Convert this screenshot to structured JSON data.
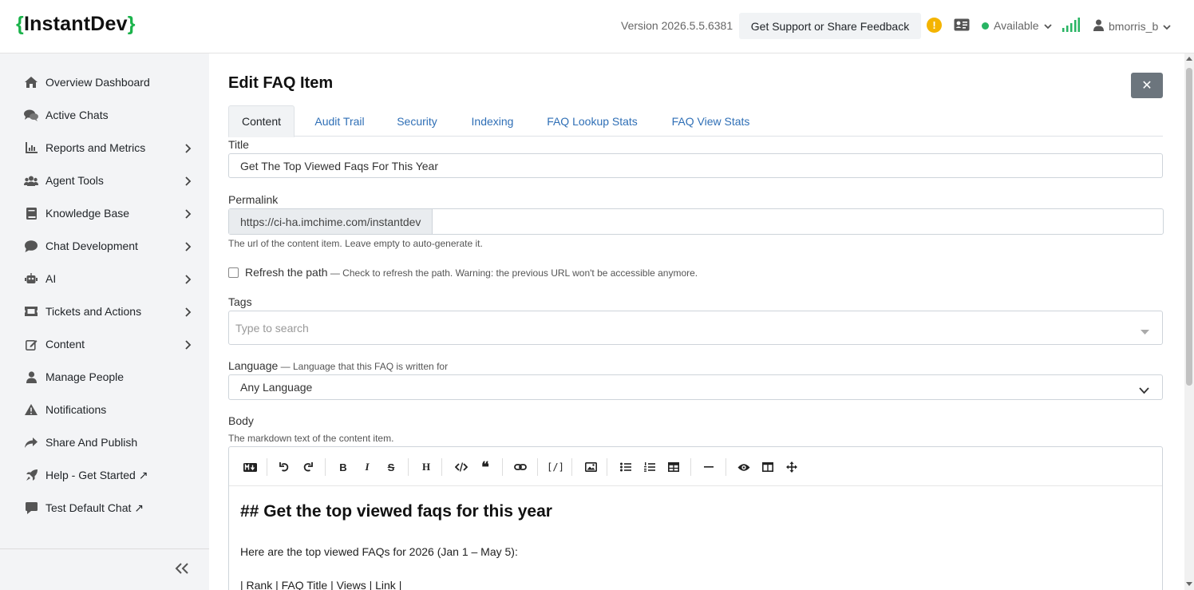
{
  "header": {
    "logo_open": "{",
    "logo_text": "InstantDev",
    "logo_close": "}",
    "version": "Version 2026.5.5.6381",
    "support_label": "Get Support or Share Feedback",
    "warning_glyph": "!",
    "status_label": "Available",
    "status_color": "#28b463",
    "username": "bmorris_b"
  },
  "sidebar": {
    "items": [
      {
        "label": "Overview Dashboard",
        "icon": "home-icon"
      },
      {
        "label": "Active Chats",
        "icon": "chats-icon"
      },
      {
        "label": "Reports and Metrics",
        "icon": "chart-icon"
      },
      {
        "label": "Agent Tools",
        "icon": "users-icon"
      },
      {
        "label": "Knowledge Base",
        "icon": "book-icon"
      },
      {
        "label": "Chat Development",
        "icon": "comment-icon"
      },
      {
        "label": "AI",
        "icon": "robot-icon"
      },
      {
        "label": "Tickets and Actions",
        "icon": "ticket-icon"
      },
      {
        "label": "Content",
        "icon": "edit-icon"
      },
      {
        "label": "Manage People",
        "icon": "person-icon"
      },
      {
        "label": "Notifications",
        "icon": "warning-icon"
      },
      {
        "label": "Share And Publish",
        "icon": "share-icon"
      },
      {
        "label": "Help - Get Started ↗",
        "icon": "rocket-icon"
      },
      {
        "label": "Test Default Chat ↗",
        "icon": "chat-bubble-icon"
      }
    ]
  },
  "page": {
    "title": "Edit FAQ Item",
    "close_glyph": "✕",
    "tabs": [
      "Content",
      "Audit Trail",
      "Security",
      "Indexing",
      "FAQ Lookup Stats",
      "FAQ View Stats"
    ],
    "active_tab": "Content"
  },
  "form": {
    "title_label": "Title",
    "title_value": "Get The Top Viewed Faqs For This Year",
    "permalink_label": "Permalink",
    "permalink_prefix": "https://ci-ha.imchime.com/instantdev",
    "permalink_value": "",
    "permalink_help": "The url of the content item. Leave empty to auto-generate it.",
    "refresh_label": "Refresh the path",
    "refresh_hint": " — Check to refresh the path. Warning: the previous URL won't be accessible anymore.",
    "tags_label": "Tags",
    "tags_placeholder": "Type to search",
    "language_label": "Language",
    "language_hint": " — Language that this FAQ is written for",
    "language_value": "Any Language",
    "body_label": "Body",
    "body_help": "The markdown text of the content item."
  },
  "editor": {
    "toolbar_items": [
      "markdown",
      "undo",
      "redo",
      "bold",
      "italic",
      "strikethrough",
      "heading",
      "code",
      "quote",
      "link",
      "code-block",
      "image",
      "bulleted-list",
      "numbered-list",
      "table",
      "horizontal-rule",
      "preview",
      "side-by-side",
      "fullscreen"
    ],
    "heading_line": "## Get the top viewed faqs for this year",
    "paragraph_line": "Here are the top viewed FAQs for 2026 (Jan 1 – May 5):",
    "table_header_line": "| Rank | FAQ Title | Views | Link |"
  }
}
